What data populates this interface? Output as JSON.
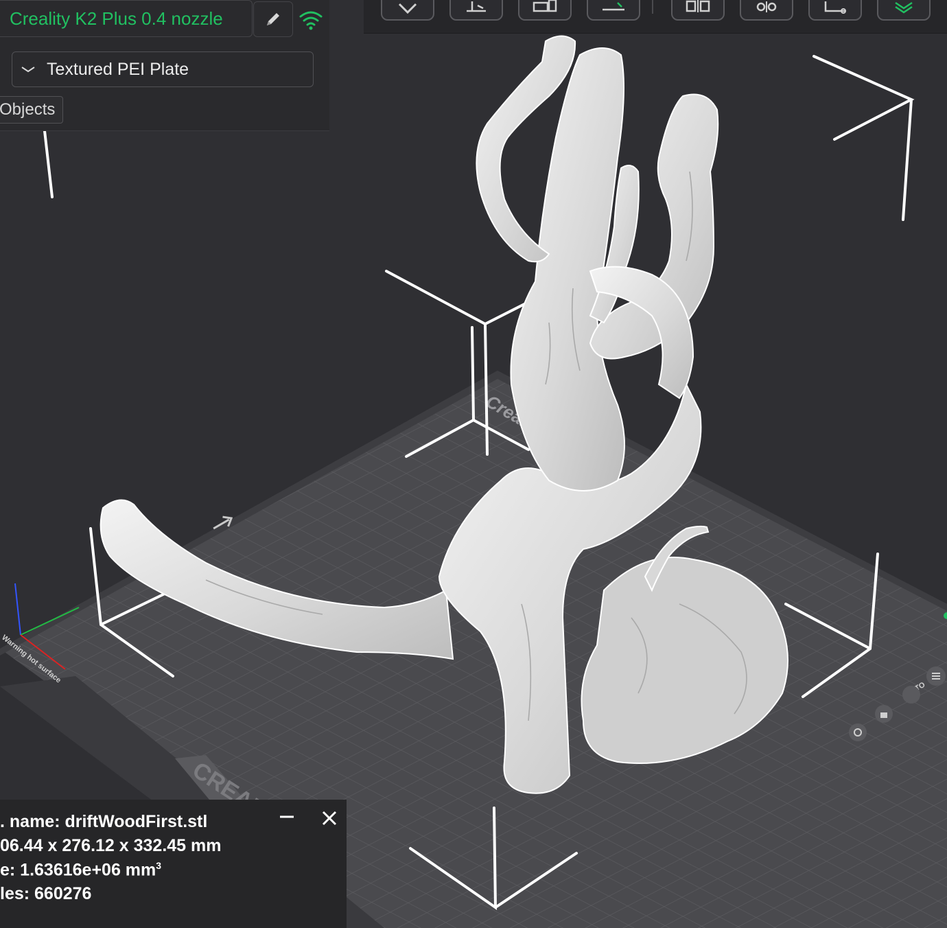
{
  "printer": {
    "name": "Creality K2 Plus 0.4 nozzle",
    "edit_icon": "pencil-icon",
    "connection_icon": "wifi-icon",
    "accent_color": "#21c061"
  },
  "plate": {
    "selected": "Textured PEI Plate",
    "dropdown_icon": "chevron-down-icon"
  },
  "tabs": {
    "objects_label": "Objects"
  },
  "toolbar": {
    "icons": [
      "place-on-face-icon",
      "auto-arrange-icon",
      "layout-icon",
      "cut-icon",
      "split-icon",
      "settings-icon",
      "measure-icon",
      "slice-icon"
    ]
  },
  "bed": {
    "brand_label": "CREALITY",
    "logo_text": "Creal",
    "warning_label": "Warning hot surface",
    "auto_label": "AUTO"
  },
  "model_info": {
    "name_line": ". name: driftWoodFirst.stl",
    "size_line": "06.44 x 276.12 x 332.45 mm",
    "volume_line": "e: 1.63616e+06 mm",
    "volume_unit_sup": "3",
    "facets_line": "les: 660276",
    "minimize_icon": "minus-icon",
    "close_icon": "close-icon"
  },
  "colors": {
    "background": "#2f2f33",
    "bed": "#4a4a4e",
    "grid": "#5e5e62",
    "model": "#dcdcdc",
    "bounding_box": "#ffffff"
  }
}
